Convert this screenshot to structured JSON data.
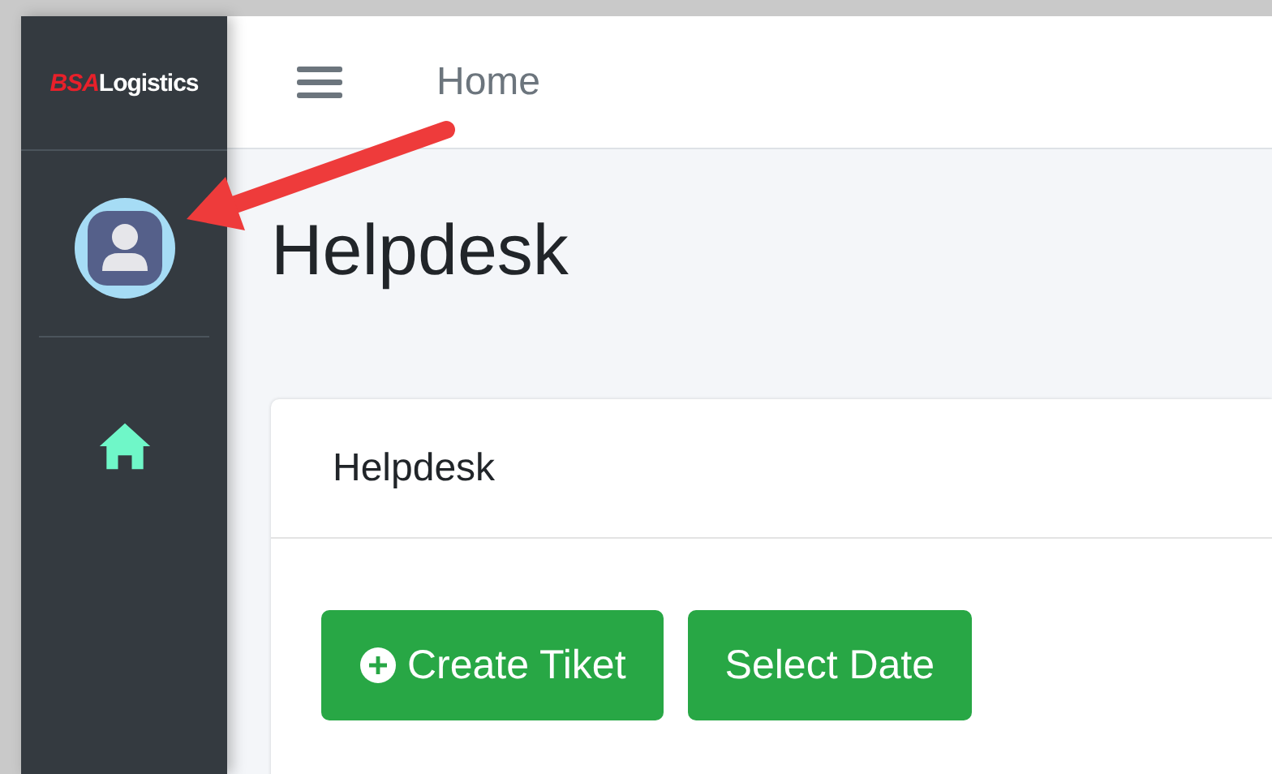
{
  "sidebar": {
    "logo": {
      "mark": "BSA",
      "name": "Logistics"
    },
    "items": [
      {
        "kind": "home",
        "selected": true
      }
    ]
  },
  "topbar": {
    "breadcrumb": "Home"
  },
  "page_title": "Helpdesk",
  "card": {
    "title": "Helpdesk",
    "buttons": [
      {
        "label": "Create Tiket",
        "kind": "add"
      },
      {
        "label": "Select Date",
        "kind": "plain"
      }
    ]
  }
}
